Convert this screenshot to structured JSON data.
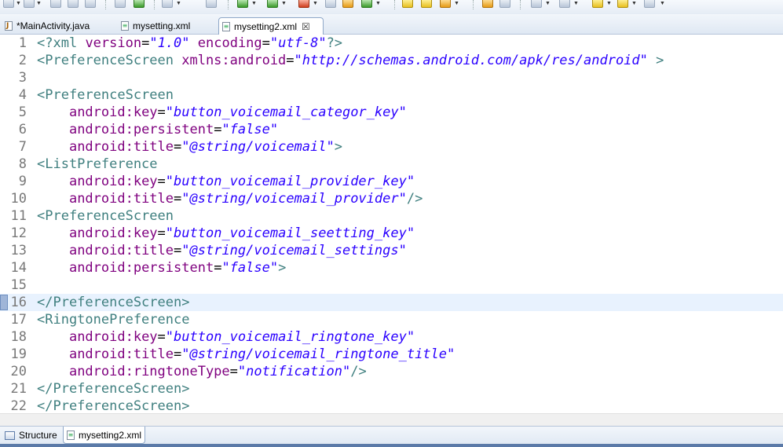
{
  "editor_tabs": [
    {
      "label": "*MainActivity.java",
      "active": false,
      "icon": "java-file-icon"
    },
    {
      "label": "mysetting.xml",
      "active": false,
      "icon": "xml-file-icon"
    },
    {
      "label": "mysetting2.xml",
      "active": true,
      "icon": "xml-file-icon",
      "close": "☒"
    }
  ],
  "bottom_tabs": [
    {
      "label": "Structure",
      "active": false
    },
    {
      "label": "mysetting2.xml",
      "active": true
    }
  ],
  "current_line": 16,
  "colors": {
    "tag": "#3f7f7f",
    "attribute": "#7f007f",
    "value": "#2a00ff",
    "line_number": "#787878",
    "current_line_bg": "#e8f2fe"
  },
  "code_lines": [
    {
      "n": "1",
      "tokens": [
        [
          "t",
          "<?"
        ],
        [
          "t",
          "xml "
        ],
        [
          "a",
          "version"
        ],
        [
          "p",
          "="
        ],
        [
          "v",
          "\"1.0\""
        ],
        [
          "a",
          " encoding"
        ],
        [
          "p",
          "="
        ],
        [
          "v",
          "\"utf-8\""
        ],
        [
          "t",
          "?>"
        ]
      ]
    },
    {
      "n": "2",
      "tokens": [
        [
          "t",
          "<PreferenceScreen "
        ],
        [
          "a",
          "xmlns:android"
        ],
        [
          "p",
          "="
        ],
        [
          "v",
          "\"http://schemas.android.com/apk/res/android\""
        ],
        [
          "t",
          " >"
        ]
      ]
    },
    {
      "n": "3",
      "tokens": []
    },
    {
      "n": "4",
      "tokens": [
        [
          "t",
          "<PreferenceScreen"
        ]
      ]
    },
    {
      "n": "5",
      "tokens": [
        [
          "p",
          "    "
        ],
        [
          "a",
          "android:key"
        ],
        [
          "p",
          "="
        ],
        [
          "v",
          "\"button_voicemail_categor_key\""
        ]
      ]
    },
    {
      "n": "6",
      "tokens": [
        [
          "p",
          "    "
        ],
        [
          "a",
          "android:persistent"
        ],
        [
          "p",
          "="
        ],
        [
          "v",
          "\"false\""
        ]
      ]
    },
    {
      "n": "7",
      "tokens": [
        [
          "p",
          "    "
        ],
        [
          "a",
          "android:title"
        ],
        [
          "p",
          "="
        ],
        [
          "v",
          "\"@string/voicemail\""
        ],
        [
          "t",
          ">"
        ]
      ]
    },
    {
      "n": "8",
      "tokens": [
        [
          "t",
          "<ListPreference"
        ]
      ]
    },
    {
      "n": "9",
      "tokens": [
        [
          "p",
          "    "
        ],
        [
          "a",
          "android:key"
        ],
        [
          "p",
          "="
        ],
        [
          "v",
          "\"button_voicemail_provider_key\""
        ]
      ]
    },
    {
      "n": "10",
      "tokens": [
        [
          "p",
          "    "
        ],
        [
          "a",
          "android:title"
        ],
        [
          "p",
          "="
        ],
        [
          "v",
          "\"@string/voicemail_provider\""
        ],
        [
          "t",
          "/>"
        ]
      ]
    },
    {
      "n": "11",
      "tokens": [
        [
          "t",
          "<PreferenceScreen"
        ]
      ]
    },
    {
      "n": "12",
      "tokens": [
        [
          "p",
          "    "
        ],
        [
          "a",
          "android:key"
        ],
        [
          "p",
          "="
        ],
        [
          "v",
          "\"button_voicemail_seetting_key\""
        ]
      ]
    },
    {
      "n": "13",
      "tokens": [
        [
          "p",
          "    "
        ],
        [
          "a",
          "android:title"
        ],
        [
          "p",
          "="
        ],
        [
          "v",
          "\"@string/voicemail_settings\""
        ]
      ]
    },
    {
      "n": "14",
      "tokens": [
        [
          "p",
          "    "
        ],
        [
          "a",
          "android:persistent"
        ],
        [
          "p",
          "="
        ],
        [
          "v",
          "\"false\""
        ],
        [
          "t",
          ">"
        ]
      ]
    },
    {
      "n": "15",
      "tokens": []
    },
    {
      "n": "16",
      "tokens": [
        [
          "t",
          "</PreferenceScreen>"
        ]
      ]
    },
    {
      "n": "17",
      "tokens": [
        [
          "t",
          "<RingtonePreference"
        ]
      ]
    },
    {
      "n": "18",
      "tokens": [
        [
          "p",
          "    "
        ],
        [
          "a",
          "android:key"
        ],
        [
          "p",
          "="
        ],
        [
          "v",
          "\"button_voicemail_ringtone_key\""
        ]
      ]
    },
    {
      "n": "19",
      "tokens": [
        [
          "p",
          "    "
        ],
        [
          "a",
          "android:title"
        ],
        [
          "p",
          "="
        ],
        [
          "v",
          "\"@string/voicemail_ringtone_title\""
        ]
      ]
    },
    {
      "n": "20",
      "tokens": [
        [
          "p",
          "    "
        ],
        [
          "a",
          "android:ringtoneType"
        ],
        [
          "p",
          "="
        ],
        [
          "v",
          "\"notification\""
        ],
        [
          "t",
          "/>"
        ]
      ]
    },
    {
      "n": "21",
      "tokens": [
        [
          "t",
          "</PreferenceScreen>"
        ]
      ]
    },
    {
      "n": "22",
      "tokens": [
        [
          "t",
          "</PreferenceScreen>"
        ]
      ]
    }
  ]
}
